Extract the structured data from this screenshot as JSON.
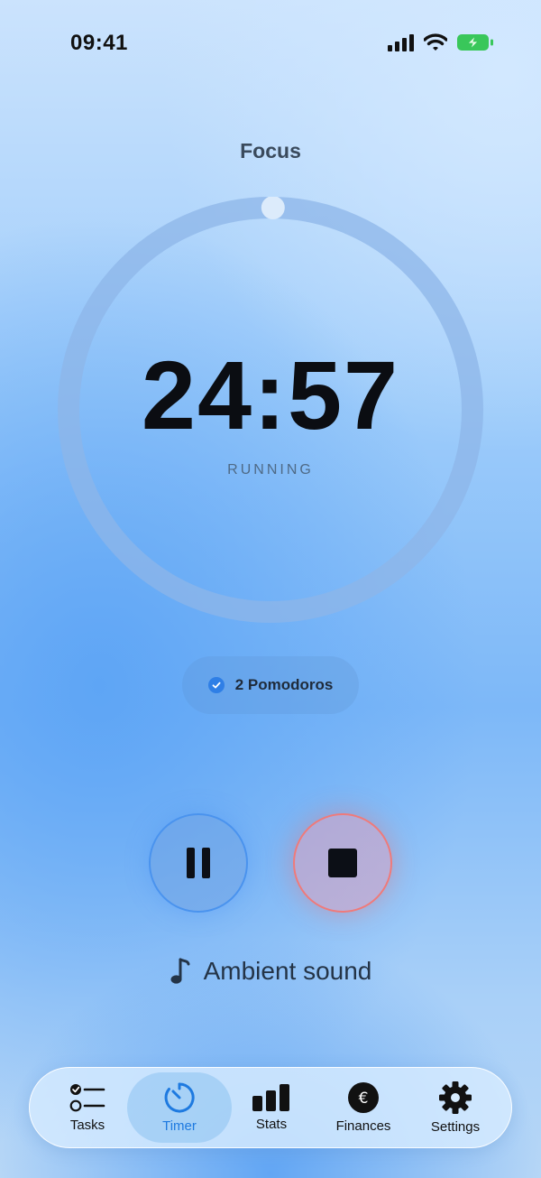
{
  "status_bar": {
    "time": "09:41",
    "icons": [
      "signal-icon",
      "wifi-icon",
      "battery-charging-icon"
    ]
  },
  "timer": {
    "mode": "Focus",
    "time": "24:57",
    "state": "RUNNING",
    "progress": 0.002,
    "ring_color": "#8db6e8",
    "knob_color": "#dcebfb"
  },
  "session": {
    "label": "2 Pomodoros",
    "icon": "check-circle-icon"
  },
  "controls": {
    "pause_icon": "pause-icon",
    "stop_icon": "stop-icon"
  },
  "ambient": {
    "label": "Ambient sound",
    "icon": "music-note-icon"
  },
  "tab_bar": {
    "active": "Timer",
    "tabs": [
      {
        "label": "Tasks",
        "icon": "checklist-icon"
      },
      {
        "label": "Timer",
        "icon": "timer-icon"
      },
      {
        "label": "Stats",
        "icon": "bar-chart-icon"
      },
      {
        "label": "Finances",
        "icon": "euro-icon"
      },
      {
        "label": "Settings",
        "icon": "gear-icon"
      }
    ]
  },
  "colors": {
    "accent": "#1e7ae0",
    "stop": "#ef7a7a"
  }
}
